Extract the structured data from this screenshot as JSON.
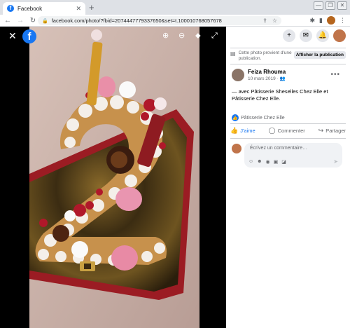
{
  "browser": {
    "tab_title": "Facebook",
    "tab_close": "✕",
    "new_tab": "+",
    "url": "facebook.com/photo/?fbid=2074447779337650&set=t.100010768057678",
    "window_buttons": [
      "—",
      "❐",
      "✕"
    ]
  },
  "viewer": {
    "close_glyph": "✕",
    "fb_logo": "f",
    "tools": [
      "zoom-in-icon",
      "zoom-out-icon",
      "tag-icon",
      "fullscreen-icon"
    ]
  },
  "panel": {
    "notice_text": "Cette photo provient d'une publication.",
    "show_publication": "Afficher la publication",
    "author_name": "Feiza Rhouma",
    "post_date": "10 mars 2019 · 👥",
    "caption": "— avec Pâtisserie Sheselles Chez Elle et Pâtisserie Chez Elle.",
    "reaction_text": "Pâtisserie Chez Elle",
    "actions": {
      "like": "J'aime",
      "comment": "Commenter",
      "share": "Partager"
    },
    "comment_placeholder": "Écrivez un commentaire…"
  },
  "colors": {
    "brand": "#1877f2",
    "viewer_bg": "#000000",
    "muted_text": "#65676b"
  }
}
